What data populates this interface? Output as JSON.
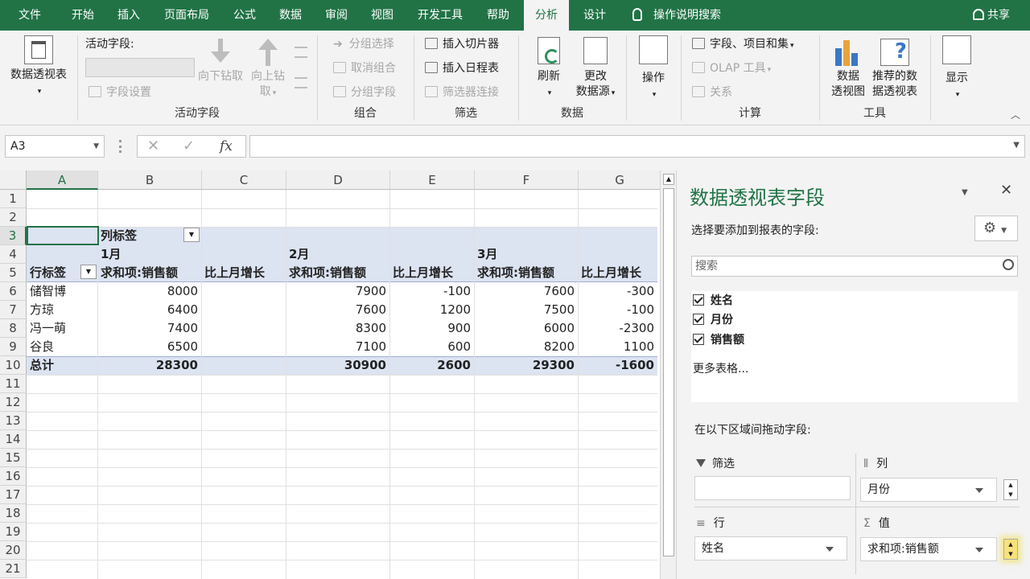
{
  "tabs": [
    "文件",
    "开始",
    "插入",
    "页面布局",
    "公式",
    "数据",
    "审阅",
    "视图",
    "开发工具",
    "帮助",
    "分析",
    "设计"
  ],
  "tell_me": "操作说明搜索",
  "share": "共享",
  "ribbon": {
    "pivot_table": "数据透视表",
    "active_field": {
      "title": "活动字段:",
      "field_settings": "字段设置",
      "drill_down": "向下钻取",
      "drill_up": "向上钻",
      "drill_up2": "取",
      "group_label": "活动字段"
    },
    "group": {
      "group_selection": "分组选择",
      "ungroup": "取消组合",
      "group_field": "分组字段",
      "label": "组合"
    },
    "filter": {
      "insert_slicer": "插入切片器",
      "insert_timeline": "插入日程表",
      "filter_connections": "筛选器连接",
      "label": "筛选"
    },
    "data": {
      "refresh": "刷新",
      "change_source": "更改",
      "change_source2": "数据源",
      "label": "数据"
    },
    "actions": {
      "label": "操作"
    },
    "calc": {
      "fields_items": "字段、项目和集",
      "olap": "OLAP 工具",
      "relations": "关系",
      "label": "计算"
    },
    "tools": {
      "pivot_chart": "数据",
      "pivot_chart2": "透视图",
      "recommended": "推荐的数",
      "recommended2": "据透视表",
      "label": "工具"
    },
    "show": {
      "label": "显示"
    }
  },
  "namebox": "A3",
  "fx": "fx",
  "columns": [
    "A",
    "B",
    "C",
    "D",
    "E",
    "F",
    "G"
  ],
  "rows": [
    "1",
    "2",
    "3",
    "4",
    "5",
    "6",
    "7",
    "8",
    "9",
    "10",
    "11",
    "12",
    "13",
    "14",
    "15",
    "16",
    "17",
    "18",
    "19",
    "20",
    "21"
  ],
  "pivot": {
    "col_label": "列标签",
    "row_label": "行标签",
    "months": [
      "1月",
      "2月",
      "3月"
    ],
    "sum_header": "求和项:销售额",
    "growth_header": "比上月增长",
    "data": [
      [
        "储智博",
        "8000",
        "",
        "7900",
        "-100",
        "7600",
        "-300"
      ],
      [
        "方琼",
        "6400",
        "",
        "7600",
        "1200",
        "7500",
        "-100"
      ],
      [
        "冯一萌",
        "7400",
        "",
        "8300",
        "900",
        "6000",
        "-2300"
      ],
      [
        "谷良",
        "6500",
        "",
        "7100",
        "600",
        "8200",
        "1100"
      ]
    ],
    "total": [
      "总计",
      "28300",
      "",
      "30900",
      "2600",
      "29300",
      "-1600"
    ]
  },
  "panel": {
    "title": "数据透视表字段",
    "choose": "选择要添加到报表的字段:",
    "search_placeholder": "搜索",
    "fields": [
      "姓名",
      "月份",
      "销售额"
    ],
    "more_tables": "更多表格...",
    "drag_hint": "在以下区域间拖动字段:",
    "filter_label": "筛选",
    "columns_label": "列",
    "columns_value": "月份",
    "rows_label": "行",
    "rows_value": "姓名",
    "values_label": "值",
    "values_value": "求和项:销售额"
  },
  "colors": {
    "excel_green": "#217346",
    "pivot_band": "#dce3f1"
  }
}
